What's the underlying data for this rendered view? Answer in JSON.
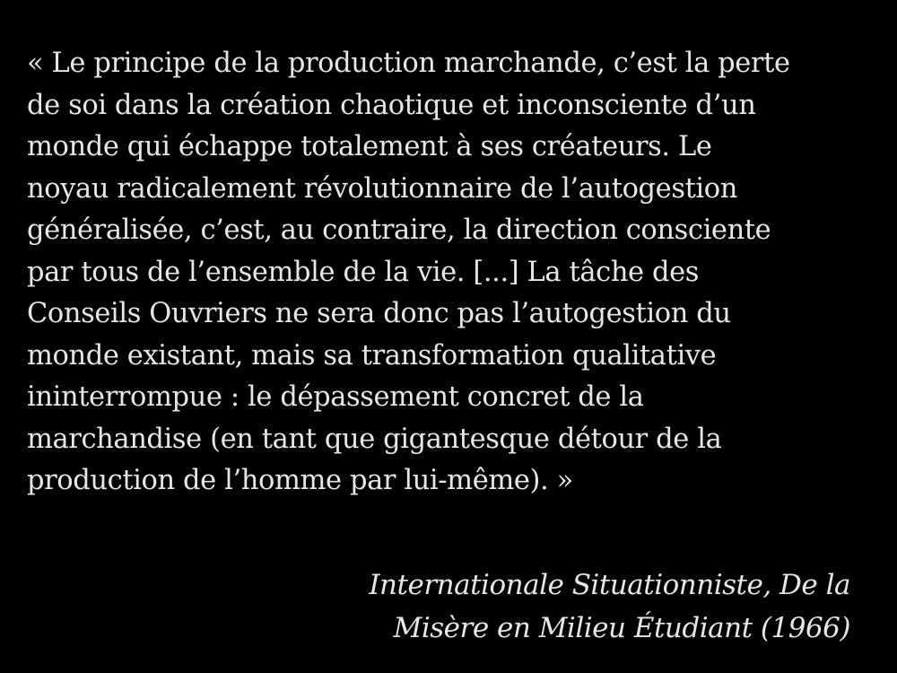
{
  "quote_lines": [
    "« Le principe de la production marchande, c’est la perte",
    "de soi dans la création chaotique et inconsciente d’un",
    "monde qui échappe totalement à ses créateurs. Le",
    "noyau radicalement révolutionnaire de l’autogestion",
    "généralisée, c’est, au contraire, la direction consciente",
    "par tous de l’ensemble de la vie. [...] La tâche des",
    "Conseils Ouvriers ne sera donc pas l’autogestion du",
    "monde existant, mais sa transformation qualitative",
    "ininterrompue : le dépassement concret de la",
    "marchandise (en tant que gigantesque détour de la",
    "production de l’homme par lui-même). »"
  ],
  "attribution_lines": [
    "Internationale Situationniste, De la",
    "Misère en Milieu Étudiant (1966)"
  ],
  "colors": {
    "background": "#000000",
    "text": "#e6e6e6"
  }
}
